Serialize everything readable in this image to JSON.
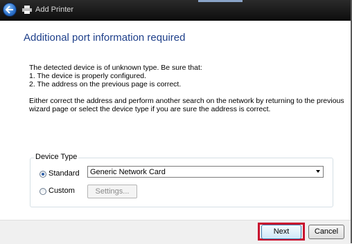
{
  "window": {
    "title": "Add Printer"
  },
  "page": {
    "heading": "Additional port information required",
    "paragraph1": [
      "The detected device is of unknown type.  Be sure that:",
      "1. The device is properly configured.",
      "2.  The address on the previous page is correct."
    ],
    "paragraph2": [
      "Either correct the address and perform another search on the network by returning to the previous",
      "wizard page or select the device type if you are sure the address is correct."
    ]
  },
  "device_type": {
    "label": "Device Type",
    "standard_label": "Standard",
    "standard_selected": true,
    "custom_label": "Custom",
    "custom_selected": false,
    "select_value": "Generic Network Card",
    "settings_label": "Settings..."
  },
  "footer": {
    "next_label": "Next",
    "cancel_label": "Cancel",
    "highlight_color": "#c8102e"
  }
}
